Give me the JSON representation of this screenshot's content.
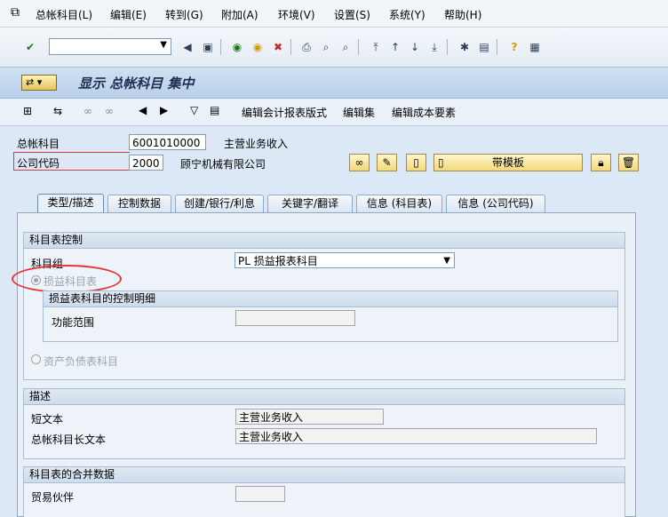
{
  "menu": [
    "总帐科目(L)",
    "编辑(E)",
    "转到(G)",
    "附加(A)",
    "环境(V)",
    "设置(S)",
    "系统(Y)",
    "帮助(H)"
  ],
  "title": "显示 总帐科目 集中",
  "app_toolbar": {
    "edit_report_layout": "编辑会计报表版式",
    "edit_set": "编辑集",
    "edit_cost_element": "编辑成本要素"
  },
  "header": {
    "gl_account_label": "总帐科目",
    "gl_account_value": "6001010000",
    "gl_account_desc": "主营业务收入",
    "company_code_label": "公司代码",
    "company_code_value": "2000",
    "company_name": "顾宁机械有限公司",
    "template_button": "带模板"
  },
  "tabs": [
    "类型/描述",
    "控制数据",
    "创建/银行/利息",
    "关键字/翻译",
    "信息 (科目表)",
    "信息 (公司代码)"
  ],
  "coa_control": {
    "title": "科目表控制",
    "account_group_label": "科目组",
    "account_group_value": "PL 损益报表科目",
    "pl_account_label": "损益科目表",
    "pl_detail_title": "损益表科目的控制明细",
    "functional_area_label": "功能范围",
    "functional_area_value": "",
    "bs_account_label": "资产负债表科目"
  },
  "description": {
    "title": "描述",
    "short_text_label": "短文本",
    "short_text_value": "主营业务收入",
    "long_text_label": "总帐科目长文本",
    "long_text_value": "主营业务收入"
  },
  "consolidation": {
    "title": "科目表的合并数据",
    "trading_partner_label": "贸易伙伴",
    "trading_partner_value": ""
  },
  "icons": {
    "accent_red": "#e0373a",
    "tab_active_bg": "#e9f0f8"
  }
}
